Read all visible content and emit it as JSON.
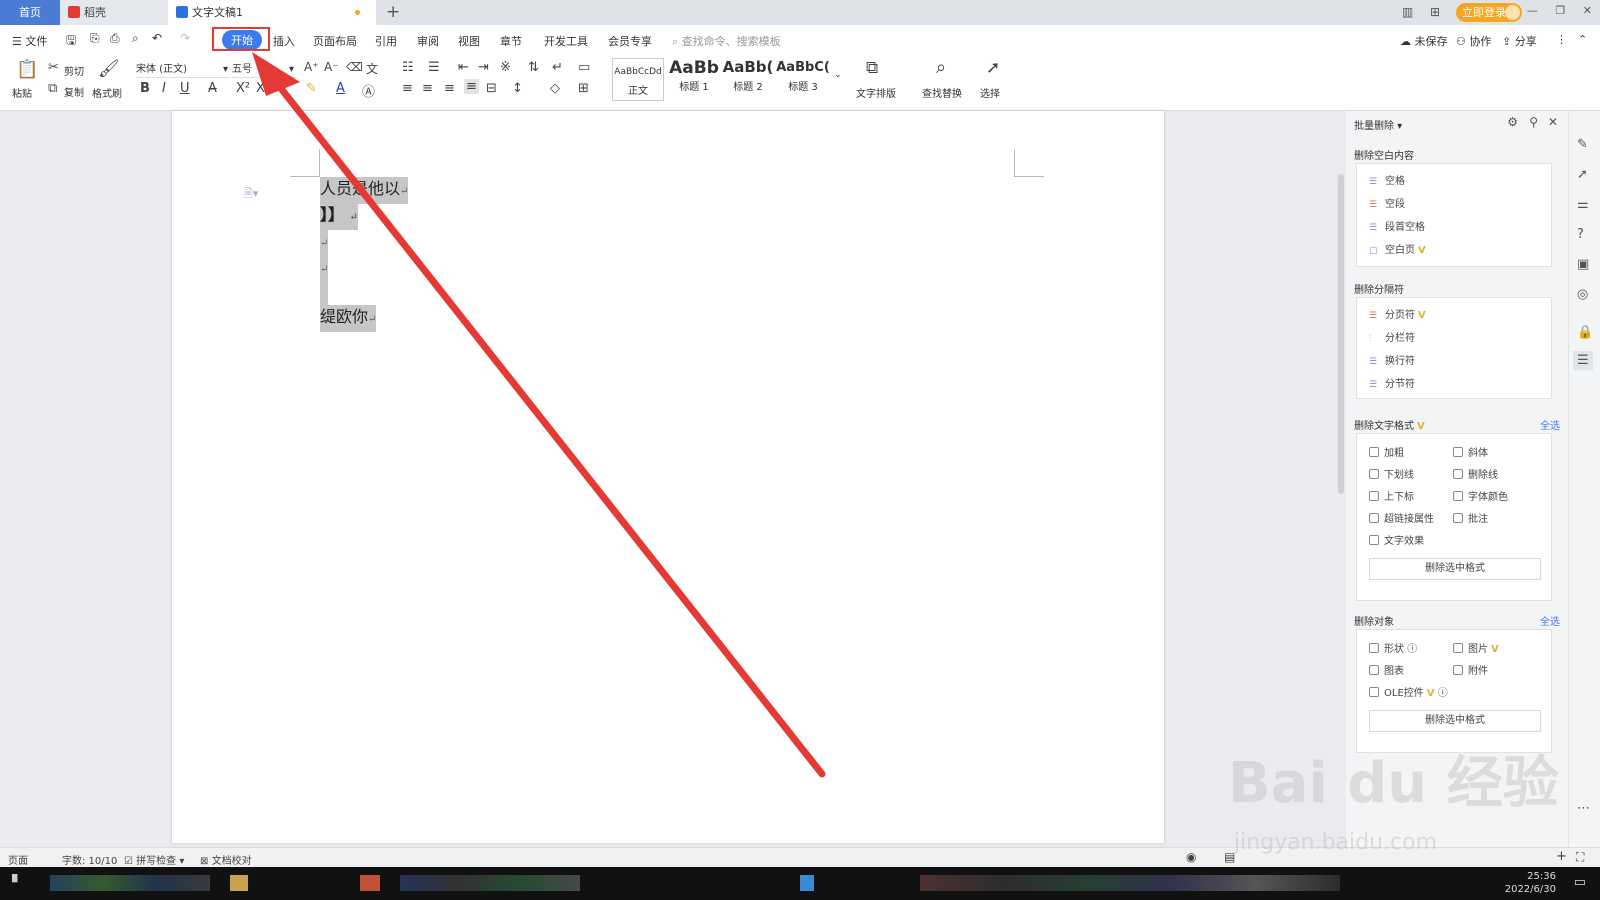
{
  "tabs": {
    "home": "首页",
    "docer": "稻壳",
    "document": "文字文稿1",
    "login": "立即登录"
  },
  "menu": {
    "file": "文件",
    "items": [
      "开始",
      "插入",
      "页面布局",
      "引用",
      "审阅",
      "视图",
      "章节",
      "开发工具",
      "会员专享"
    ],
    "search_placeholder": "查找命令、搜索模板",
    "unsaved": "未保存",
    "collab": "协作",
    "share": "分享"
  },
  "ribbon": {
    "paste": "粘贴",
    "cut": "剪切",
    "copy": "复制",
    "format_painter": "格式刷",
    "font_name": "宋体 (正文)",
    "font_size": "五号",
    "styles": [
      {
        "preview": "AaBbCcDd",
        "label": "正文"
      },
      {
        "preview": "AaBb",
        "label": "标题 1"
      },
      {
        "preview": "AaBb(",
        "label": "标题 2"
      },
      {
        "preview": "AaBbC(",
        "label": "标题 3"
      }
    ],
    "text_layout": "文字排版",
    "find_replace": "查找替换",
    "select": "选择"
  },
  "document": {
    "lines": [
      "人员是他以",
      "】】",
      "",
      "",
      "缇欧你"
    ]
  },
  "panel": {
    "title": "批量删除",
    "blank_section": "删除空白内容",
    "blank_items": [
      "空格",
      "空段",
      "段首空格",
      "空白页"
    ],
    "separator_section": "删除分隔符",
    "separator_items": [
      "分页符",
      "分栏符",
      "换行符",
      "分节符"
    ],
    "format_section": "删除文字格式",
    "select_all": "全选",
    "format_items": [
      "加粗",
      "斜体",
      "下划线",
      "删除线",
      "上下标",
      "字体颜色",
      "超链接属性",
      "批注",
      "文字效果"
    ],
    "delete_format_btn": "删除选中格式",
    "object_section": "删除对象",
    "object_items": [
      "形状",
      "图片",
      "图表",
      "附件",
      "OLE控件"
    ],
    "delete_object_btn": "删除选中格式",
    "vip": "V"
  },
  "status": {
    "page": "页面",
    "word_count": "字数: 10/10",
    "spell_check": "拼写检查",
    "proofread": "文档校对"
  },
  "taskbar": {
    "time": "25:36",
    "date": "2022/6/30"
  },
  "watermark": {
    "logo": "Bai du 经验",
    "url": "jingyan.baidu.com"
  },
  "colors": {
    "accent": "#3d7af0",
    "arrow": "#e53935",
    "vip": "#e2b13c"
  }
}
